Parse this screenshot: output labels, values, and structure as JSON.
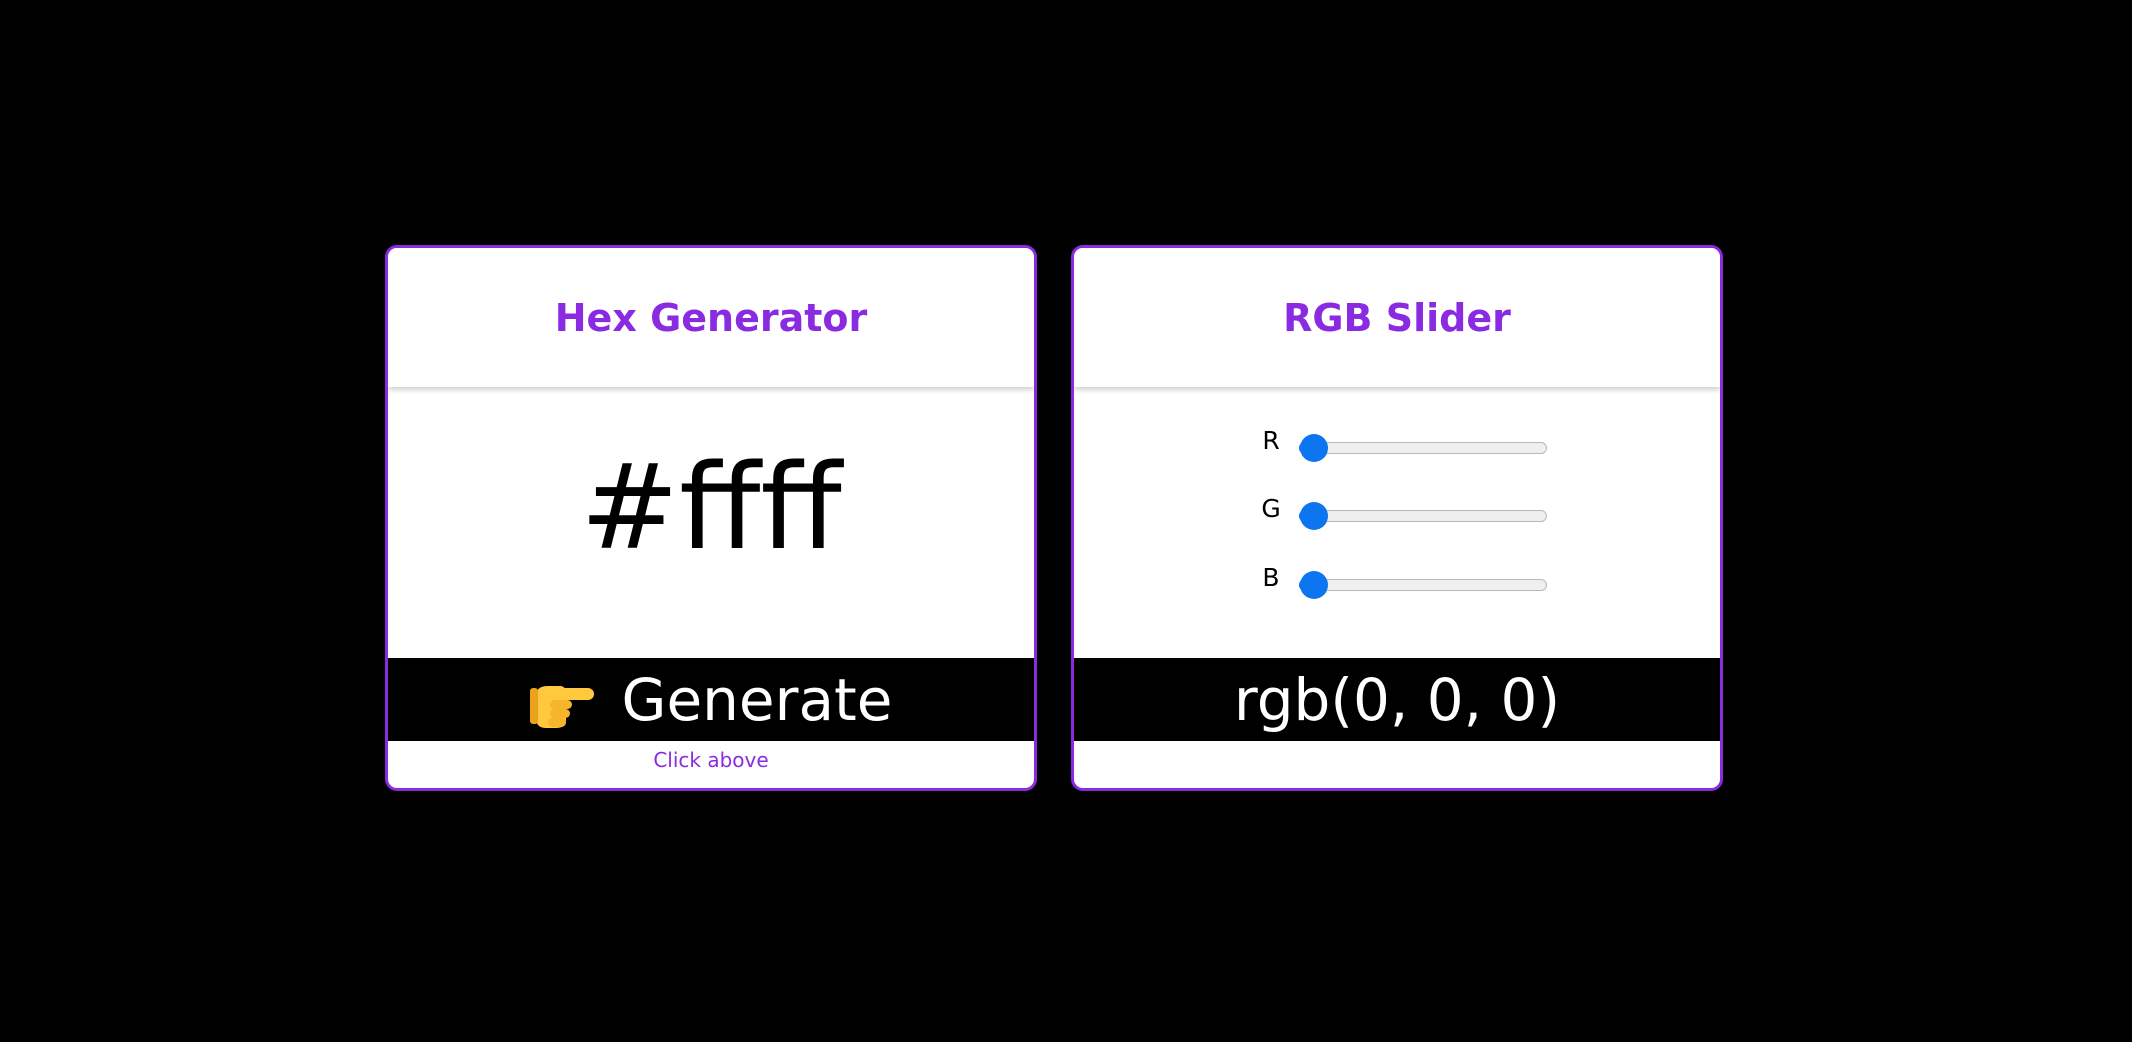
{
  "hex_card": {
    "title": "Hex Generator",
    "hex_value": "#ffff",
    "generate_label": "Generate",
    "hint": "Click above",
    "hand_icon": "pointing-right-hand-icon"
  },
  "rgb_card": {
    "title": "RGB Slider",
    "rgb_text": "rgb(0, 0, 0)",
    "sliders": [
      {
        "label": "R",
        "value": 0,
        "min": 0,
        "max": 255
      },
      {
        "label": "G",
        "value": 0,
        "min": 0,
        "max": 255
      },
      {
        "label": "B",
        "value": 0,
        "min": 0,
        "max": 255
      }
    ]
  },
  "colors": {
    "accent": "#8a2be2",
    "background": "#000000",
    "slider": "#0d75f0"
  }
}
